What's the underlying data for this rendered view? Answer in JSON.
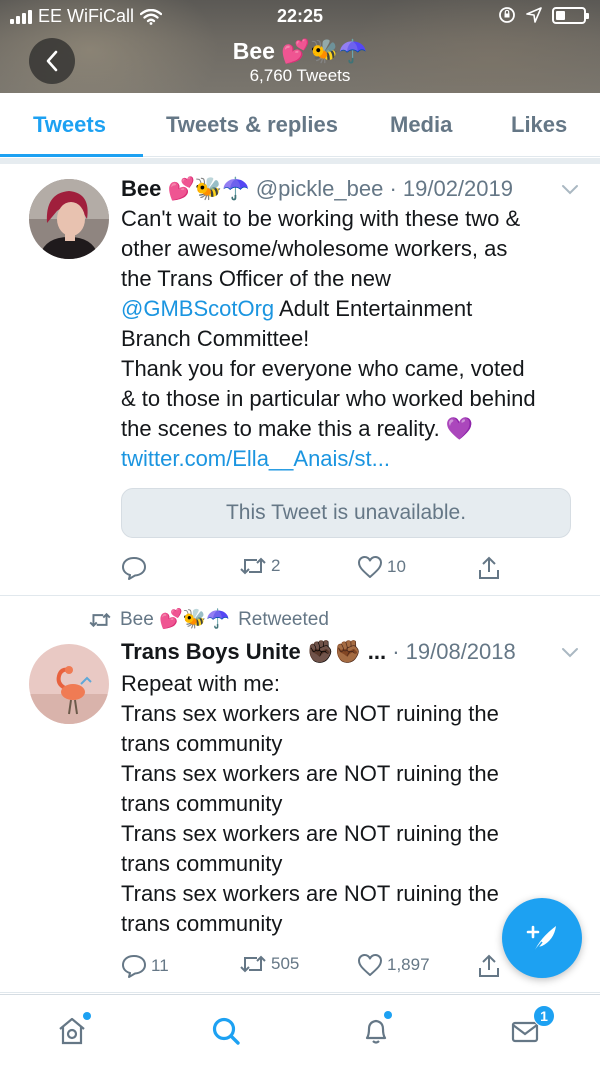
{
  "status_bar": {
    "carrier": "EE WiFiCall",
    "time": "22:25"
  },
  "profile_header": {
    "name": "Bee 💕🐝☂️",
    "tweet_count": "6,760 Tweets"
  },
  "tabs": [
    {
      "label": "Tweets",
      "active": true
    },
    {
      "label": "Tweets & replies",
      "active": false
    },
    {
      "label": "Media",
      "active": false
    },
    {
      "label": "Likes",
      "active": false
    }
  ],
  "tweets": [
    {
      "name": "Bee 💕🐝☂️",
      "handle": "@pickle_bee",
      "date": "· 19/02/2019",
      "body_lines": [
        "Can't wait to be working with these two &",
        "other awesome/wholesome workers, as",
        "the Trans Officer of the new"
      ],
      "mention": "@GMBScotOrg",
      "mention_rest": " Adult Entertainment",
      "body_lines_2": [
        "Branch Committee!",
        "Thank you for everyone who came, voted",
        "& to those in particular who worked behind",
        "the scenes to make this a reality. 💜"
      ],
      "link": "twitter.com/Ella__Anais/st...",
      "quote_text": "This Tweet is unavailable.",
      "retweets": "2",
      "likes": "10"
    },
    {
      "retweeted_by": "Bee 💕🐝☂️",
      "retweeted_label": "Retweeted",
      "name": "Trans Boys Unite ✊🏿✊🏾 ...",
      "date": "· 19/08/2018",
      "body_lines": [
        "Repeat with me:",
        "Trans sex workers are NOT ruining the",
        "trans community",
        "Trans sex workers are NOT ruining the",
        "trans community",
        "Trans sex workers are NOT ruining the",
        "trans community",
        "Trans sex workers are NOT ruining the",
        "trans community"
      ],
      "replies": "11",
      "retweets": "505",
      "likes": "1,897"
    }
  ],
  "bottom_nav": {
    "messages_badge": "1"
  },
  "colors": {
    "accent": "#1da1f2",
    "link": "#1b95e0",
    "muted": "#657786"
  }
}
